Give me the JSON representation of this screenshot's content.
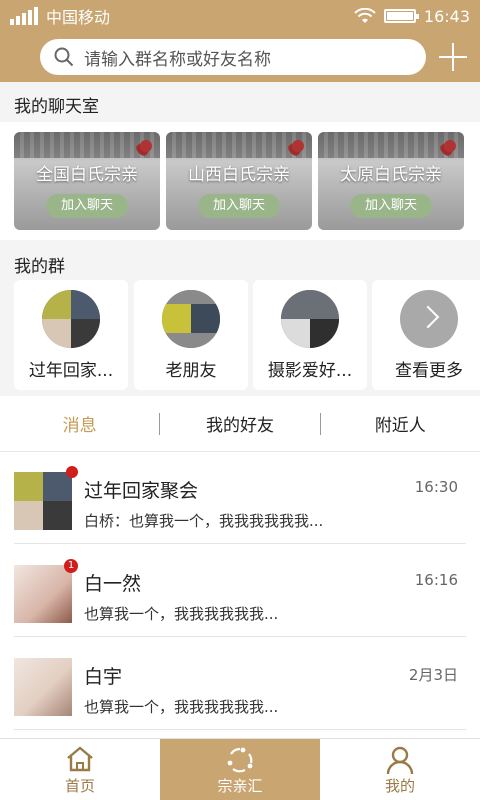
{
  "status_bar": {
    "carrier": "中国移动",
    "time": "16:43"
  },
  "search": {
    "placeholder": "请输入群名称或好友名称"
  },
  "chat_rooms": {
    "title": "我的聊天室",
    "items": [
      {
        "name": "全国白氏宗亲",
        "button": "加入聊天"
      },
      {
        "name": "山西白氏宗亲",
        "button": "加入聊天"
      },
      {
        "name": "太原白氏宗亲",
        "button": "加入聊天"
      }
    ]
  },
  "groups": {
    "title": "我的群",
    "items": [
      {
        "name": "过年回家..."
      },
      {
        "name": "老朋友"
      },
      {
        "name": "摄影爱好..."
      }
    ],
    "more_label": "查看更多"
  },
  "tabs": [
    {
      "label": "消息",
      "active": true
    },
    {
      "label": "我的好友",
      "active": false
    },
    {
      "label": "附近人",
      "active": false
    }
  ],
  "messages": [
    {
      "name": "过年回家聚会",
      "time": "16:30",
      "preview": "白桥：也算我一个，我我我我我我...",
      "unread_dot": true,
      "badge": ""
    },
    {
      "name": "白一然",
      "time": "16:16",
      "preview": "也算我一个，我我我我我我...",
      "unread_dot": false,
      "badge": "1"
    },
    {
      "name": "白宇",
      "time": "2月3日",
      "preview": "也算我一个，我我我我我我...",
      "unread_dot": false,
      "badge": ""
    }
  ],
  "bottom_nav": [
    {
      "label": "首页",
      "icon": "home-icon",
      "active": false
    },
    {
      "label": "宗亲汇",
      "icon": "clan-circle-icon",
      "active": true
    },
    {
      "label": "我的",
      "icon": "person-icon",
      "active": false
    }
  ],
  "colors": {
    "brand": "#c8a571",
    "active_tab": "#c59a55",
    "join_button": "#9ab58a",
    "unread": "#d21d1d"
  }
}
